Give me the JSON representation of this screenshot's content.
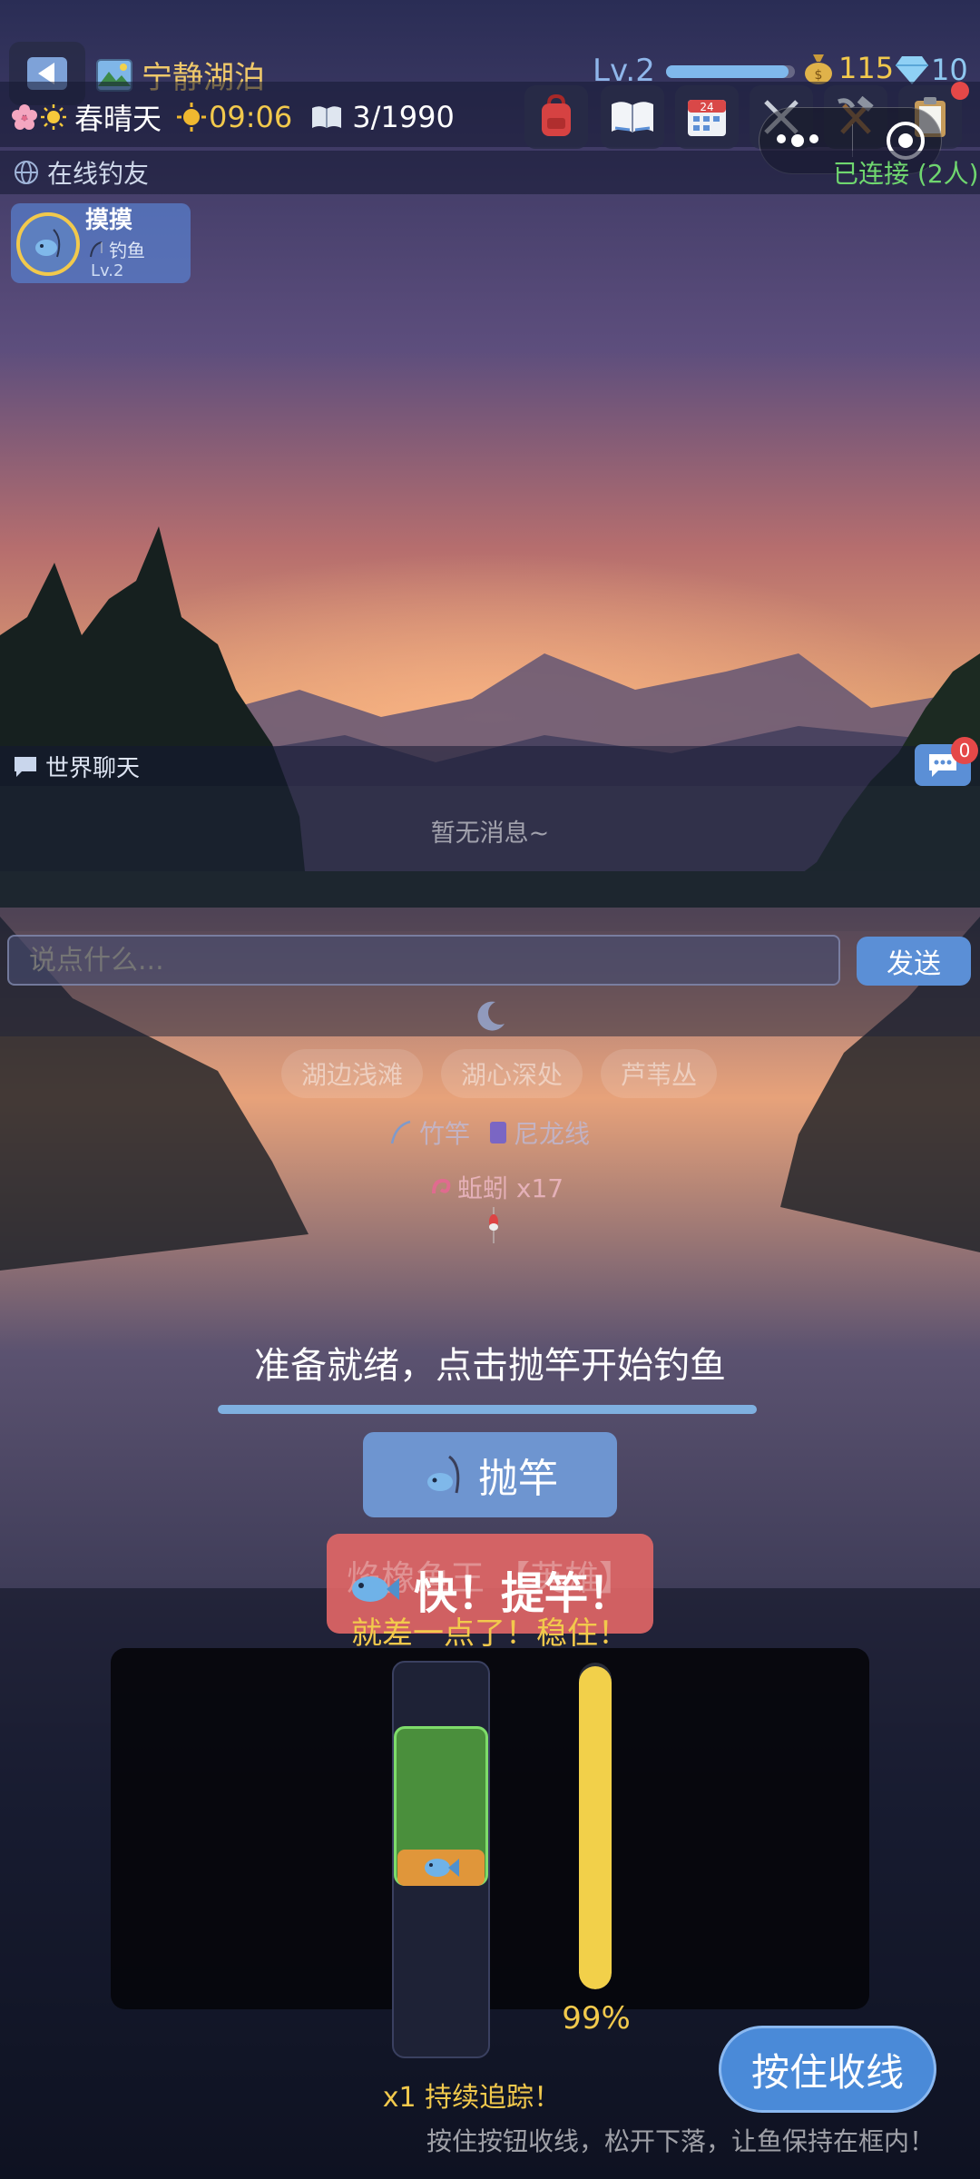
{
  "header": {
    "back_icon": "back-arrow-icon",
    "location_icon": "lake-picture-icon",
    "location": "宁静湖泊",
    "level": "Lv.2",
    "level_progress": 0.95,
    "gold": "115",
    "gems": "10",
    "season_icon": "cherry-blossom-icon",
    "weather_icon": "sun-icon",
    "weather": "春晴天",
    "time": "09:06",
    "book_icon": "book-icon",
    "collection": "3/1990",
    "toolbar": [
      {
        "icon": "backpack-icon"
      },
      {
        "icon": "open-book-icon"
      },
      {
        "icon": "calendar-icon"
      },
      {
        "icon": "crossed-swords-icon"
      },
      {
        "icon": "hammer-pick-icon"
      },
      {
        "icon": "clipboard-icon"
      }
    ],
    "connection": "已连接 (2人)"
  },
  "online": {
    "title": "在线钓友",
    "users": [
      {
        "name": "摸摸",
        "status": "钓鱼",
        "level": "Lv.2"
      }
    ]
  },
  "chat": {
    "title": "世界聊天",
    "unread": "0",
    "empty": "暂无消息~",
    "placeholder": "说点什么...",
    "send": "发送"
  },
  "fishing": {
    "spots": [
      "湖边浅滩",
      "湖心深处",
      "芦苇丛"
    ],
    "rod": "竹竿",
    "line": "尼龙线",
    "bait": "蚯蚓 x17",
    "status": "准备就绪，点击抛竿开始钓鱼",
    "cast_button": "抛竿",
    "ghost_text": "焰橡鱼王 【英雄】",
    "alert": "快！提竿！",
    "hint": "就差一点了！稳住！",
    "progress_percent": "99%",
    "progress": 0.99,
    "combo": "x1 持续追踪！",
    "reel_button": "按住收线",
    "instruction": "按住按钮收线，松开下落，让鱼保持在框内！"
  },
  "colors": {
    "accent": "#5b8fd6",
    "gold": "#f2c94c",
    "green_zone": "#4a8f3c",
    "fish_marker": "#e0963a",
    "alert_red": "#e06666",
    "connected": "#6fd66f"
  }
}
